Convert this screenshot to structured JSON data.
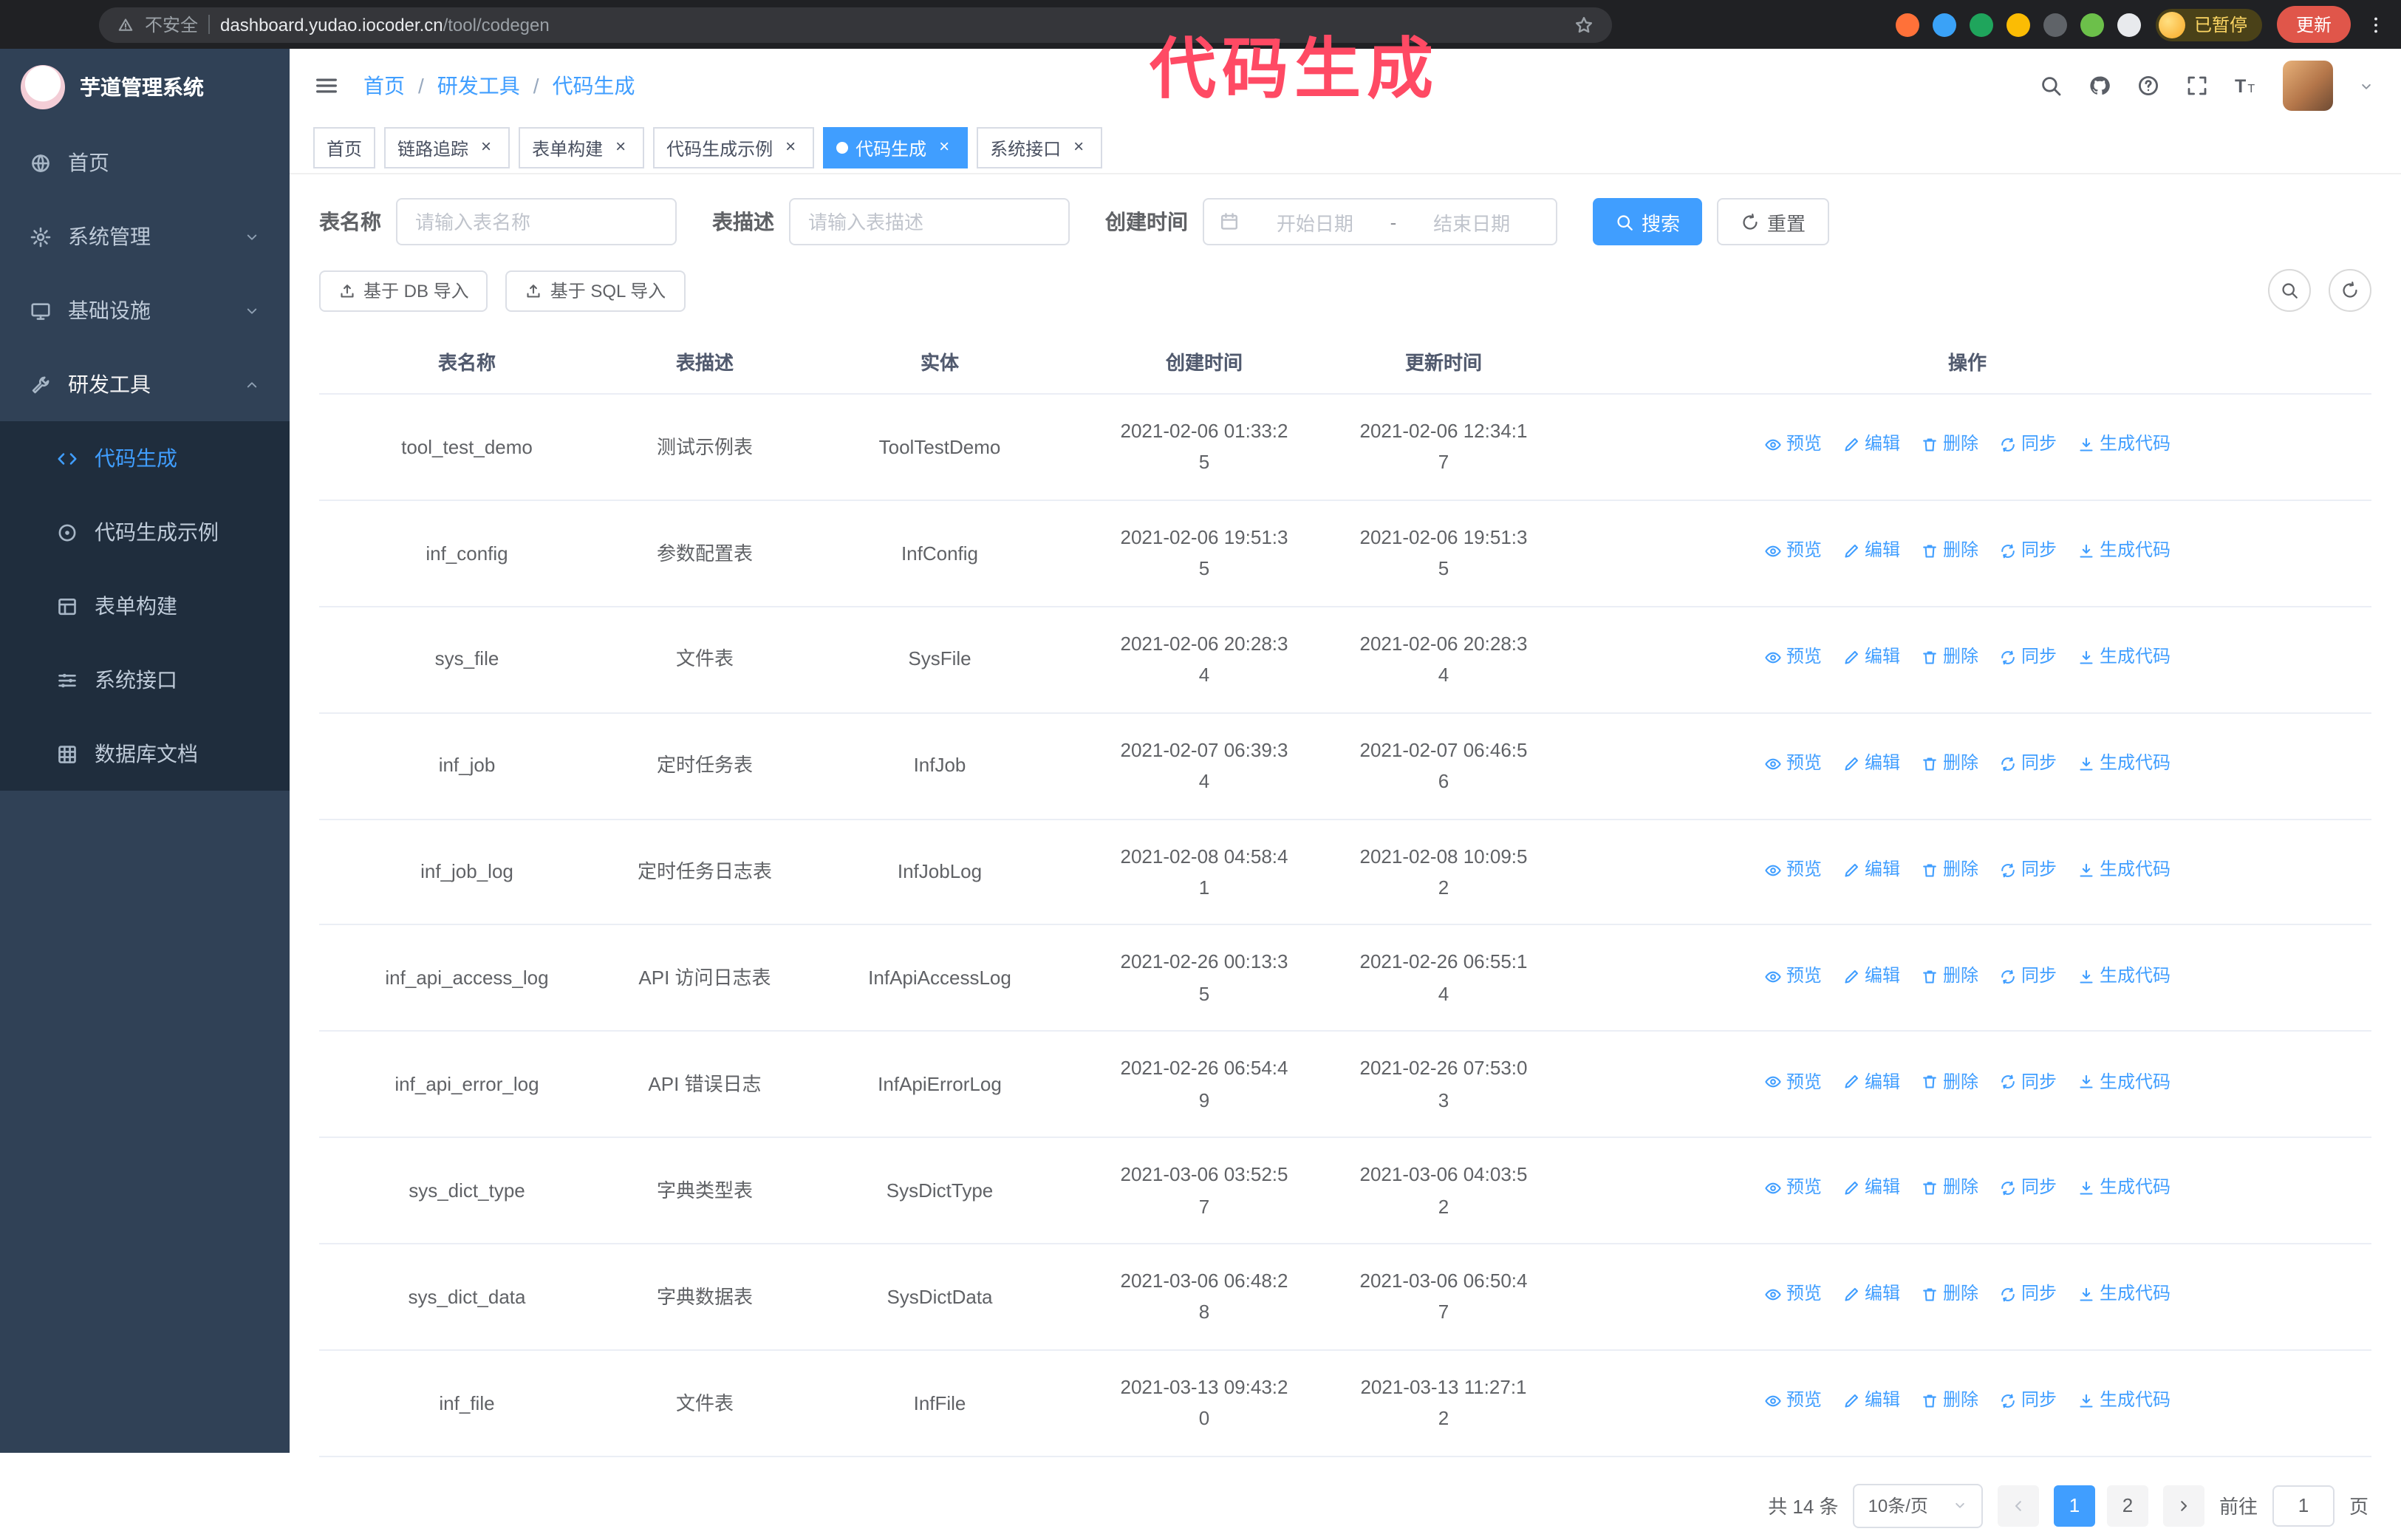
{
  "theme": {
    "accent": "#409eff",
    "sidebar-bg": "#304156",
    "submenu-bg": "#1f2d3d",
    "sidebar-text": "#bfcbd9",
    "annotation": "#ff4a64",
    "browser-bar": "#202124",
    "update-pill": "#e0564a",
    "border": "#ebeef5"
  },
  "annotation": {
    "text": "代码生成"
  },
  "browser": {
    "nav_icons": [
      "back-icon",
      "forward-icon",
      "reload-icon",
      "home-browser-icon"
    ],
    "security_text": "不安全",
    "url_host": "dashboard.yudao.iocoder.cn",
    "url_path": "/tool/codegen",
    "extensions": [
      {
        "name": "orange-extension",
        "color": "#ff7139"
      },
      {
        "name": "blue-extension",
        "color": "#3aa2f7"
      },
      {
        "name": "green-check-extension",
        "color": "#1fa55c"
      },
      {
        "name": "yellow-extension",
        "color": "#fbbc04"
      },
      {
        "name": "gray-extension",
        "color": "#5f6368"
      },
      {
        "name": "leaf-extension",
        "color": "#6cc04a"
      },
      {
        "name": "puzzle-extension",
        "color": "#e8eaed"
      }
    ],
    "profile_badge": "已暂停",
    "update_button": "更新"
  },
  "sidebar": {
    "logo_title": "芋道管理系统",
    "menu": [
      {
        "key": "home",
        "icon": "home-icon",
        "label": "首页"
      },
      {
        "key": "system",
        "icon": "gear-icon",
        "label": "系统管理",
        "chevron": "down"
      },
      {
        "key": "infra",
        "icon": "monitor-icon",
        "label": "基础设施",
        "chevron": "down"
      },
      {
        "key": "devtools",
        "icon": "tools-icon",
        "label": "研发工具",
        "chevron": "up",
        "expanded": true,
        "children": [
          {
            "key": "codegen",
            "icon": "code-icon",
            "label": "代码生成",
            "active": true
          },
          {
            "key": "codegen-example",
            "icon": "target-icon",
            "label": "代码生成示例"
          },
          {
            "key": "form-build",
            "icon": "form-icon",
            "label": "表单构建"
          },
          {
            "key": "api-doc",
            "icon": "sliders-icon",
            "label": "系统接口"
          },
          {
            "key": "db-doc",
            "icon": "grid-icon",
            "label": "数据库文档"
          }
        ]
      }
    ]
  },
  "header": {
    "breadcrumb": [
      "首页",
      "研发工具",
      "代码生成"
    ],
    "breadcrumb_separator": "/"
  },
  "tabs": [
    {
      "key": "home",
      "label": "首页",
      "closable": false,
      "active": false
    },
    {
      "key": "tracer",
      "label": "链路追踪",
      "closable": true,
      "active": false
    },
    {
      "key": "form-build",
      "label": "表单构建",
      "closable": true,
      "active": false
    },
    {
      "key": "codegen-example",
      "label": "代码生成示例",
      "closable": true,
      "active": false
    },
    {
      "key": "codegen",
      "label": "代码生成",
      "closable": true,
      "active": true
    },
    {
      "key": "api-doc",
      "label": "系统接口",
      "closable": true,
      "active": false
    }
  ],
  "filters": {
    "table_name_label": "表名称",
    "table_name_placeholder": "请输入表名称",
    "table_desc_label": "表描述",
    "table_desc_placeholder": "请输入表描述",
    "create_time_label": "创建时间",
    "date_start_placeholder": "开始日期",
    "date_separator": "-",
    "date_end_placeholder": "结束日期",
    "search_button": "搜索",
    "reset_button": "重置"
  },
  "toolbar": {
    "import_db": "基于 DB 导入",
    "import_sql": "基于 SQL 导入"
  },
  "table": {
    "columns": [
      "表名称",
      "表描述",
      "实体",
      "创建时间",
      "更新时间",
      "操作"
    ],
    "actions": [
      {
        "key": "preview",
        "icon": "eye-icon",
        "label": "预览"
      },
      {
        "key": "edit",
        "icon": "edit-icon",
        "label": "编辑"
      },
      {
        "key": "delete",
        "icon": "delete-icon",
        "label": "删除"
      },
      {
        "key": "sync",
        "icon": "sync-icon",
        "label": "同步"
      },
      {
        "key": "generate",
        "icon": "download-icon",
        "label": "生成代码"
      }
    ],
    "rows": [
      {
        "name": "tool_test_demo",
        "desc": "测试示例表",
        "entity": "ToolTestDemo",
        "created": "2021-02-06 01:33:25",
        "updated": "2021-02-06 12:34:17"
      },
      {
        "name": "inf_config",
        "desc": "参数配置表",
        "entity": "InfConfig",
        "created": "2021-02-06 19:51:35",
        "updated": "2021-02-06 19:51:35"
      },
      {
        "name": "sys_file",
        "desc": "文件表",
        "entity": "SysFile",
        "created": "2021-02-06 20:28:34",
        "updated": "2021-02-06 20:28:34"
      },
      {
        "name": "inf_job",
        "desc": "定时任务表",
        "entity": "InfJob",
        "created": "2021-02-07 06:39:34",
        "updated": "2021-02-07 06:46:56"
      },
      {
        "name": "inf_job_log",
        "desc": "定时任务日志表",
        "entity": "InfJobLog",
        "created": "2021-02-08 04:58:41",
        "updated": "2021-02-08 10:09:52"
      },
      {
        "name": "inf_api_access_log",
        "desc": "API 访问日志表",
        "entity": "InfApiAccessLog",
        "created": "2021-02-26 00:13:35",
        "updated": "2021-02-26 06:55:14"
      },
      {
        "name": "inf_api_error_log",
        "desc": "API 错误日志",
        "entity": "InfApiErrorLog",
        "created": "2021-02-26 06:54:49",
        "updated": "2021-02-26 07:53:03"
      },
      {
        "name": "sys_dict_type",
        "desc": "字典类型表",
        "entity": "SysDictType",
        "created": "2021-03-06 03:52:57",
        "updated": "2021-03-06 04:03:52"
      },
      {
        "name": "sys_dict_data",
        "desc": "字典数据表",
        "entity": "SysDictData",
        "created": "2021-03-06 06:48:28",
        "updated": "2021-03-06 06:50:47"
      },
      {
        "name": "inf_file",
        "desc": "文件表",
        "entity": "InfFile",
        "created": "2021-03-13 09:43:20",
        "updated": "2021-03-13 11:27:12"
      }
    ]
  },
  "pagination": {
    "total": "共 14 条",
    "page_size": "10条/页",
    "pages": [
      "1",
      "2"
    ],
    "active_page": "1",
    "goto_label": "前往",
    "goto_value": "1",
    "goto_unit": "页"
  }
}
